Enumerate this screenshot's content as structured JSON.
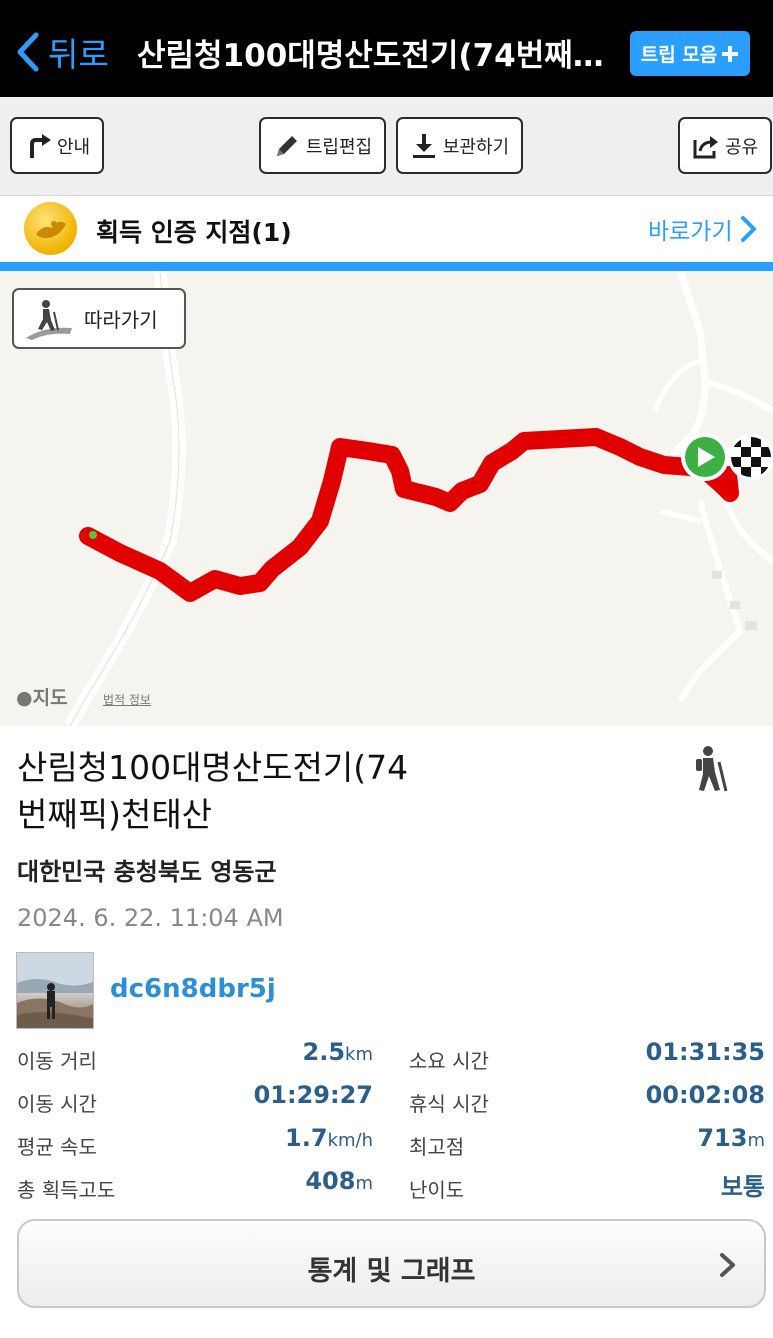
{
  "navbar": {
    "back_label": "뒤로",
    "title": "산림청100대명산도전기(74번째…",
    "trip_collect_label": "트립 모음",
    "accent_color": "#2a9fff"
  },
  "toolbar": {
    "guide_label": "안내",
    "edit_label": "트립편집",
    "save_label": "보관하기",
    "share_label": "공유"
  },
  "certification": {
    "label": "획득 인증 지점(1)",
    "link_label": "바로가기"
  },
  "map": {
    "follow_label": "따라가기",
    "logo_label": "지도",
    "legal_label": "법적 정보",
    "track_color": "#e00000"
  },
  "trip": {
    "title": "산림청100대명산도전기(74번째픽)천태산",
    "title_line1": "산림청100대명산도전기(74",
    "title_line2": "번째픽)천태산",
    "region": "대한민국 충청북도 영동군",
    "datetime": "2024. 6. 22. 11:04 AM",
    "username": "dc6n8dbr5j"
  },
  "stats": [
    {
      "label": "이동 거리",
      "value": "2.5",
      "unit": "km"
    },
    {
      "label": "소요 시간",
      "value": "01:31:35",
      "unit": ""
    },
    {
      "label": "이동 시간",
      "value": "01:29:27",
      "unit": ""
    },
    {
      "label": "휴식 시간",
      "value": "00:02:08",
      "unit": ""
    },
    {
      "label": "평균 속도",
      "value": "1.7",
      "unit": "km/h"
    },
    {
      "label": "최고점",
      "value": "713",
      "unit": "m"
    },
    {
      "label": "총 획득고도",
      "value": "408",
      "unit": "m"
    },
    {
      "label": "난이도",
      "value": "보통",
      "unit": ""
    }
  ],
  "stats_button_label": "통계 및 그래프"
}
